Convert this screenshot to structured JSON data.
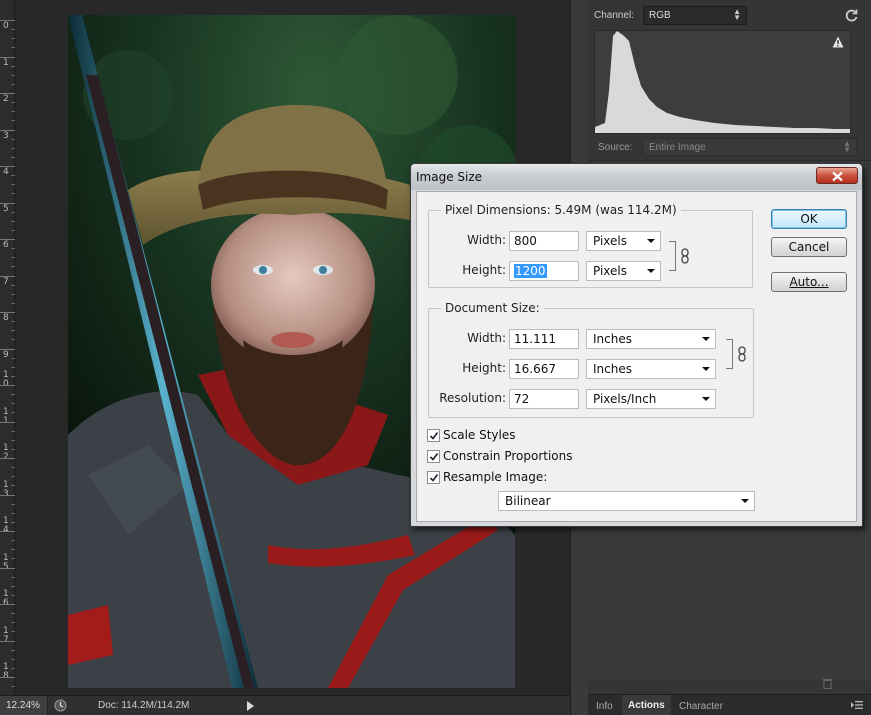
{
  "ruler": {
    "labels": [
      "0",
      "1",
      "2",
      "3",
      "4",
      "5",
      "6",
      "7",
      "8",
      "9",
      "1\n0",
      "1\n1",
      "1\n2",
      "1\n3",
      "1\n4",
      "1\n5",
      "1\n6",
      "1\n7",
      "1\n8"
    ]
  },
  "canvas": {
    "photo_description_icon": "portrait-photo"
  },
  "status_bar": {
    "zoom": "12.24%",
    "doc_size": "Doc: 114.2M/114.2M"
  },
  "histogram_panel": {
    "channel_label": "Channel:",
    "channel_value": "RGB",
    "source_label": "Source:",
    "source_value": "Entire Image"
  },
  "panel_tabs": [
    {
      "label": "Info",
      "active": false
    },
    {
      "label": "Actions",
      "active": true
    },
    {
      "label": "Character",
      "active": false
    }
  ],
  "dialog": {
    "title": "Image Size",
    "pixel_dimensions": {
      "title": "Pixel Dimensions:  5.49M (was 114.2M)",
      "width_label": "Width:",
      "width_value": "800",
      "width_unit": "Pixels",
      "height_label": "Height:",
      "height_value": "1200",
      "height_unit": "Pixels"
    },
    "document_size": {
      "title": "Document Size:",
      "width_label": "Width:",
      "width_value": "11.111",
      "width_unit": "Inches",
      "height_label": "Height:",
      "height_value": "16.667",
      "height_unit": "Inches",
      "resolution_label": "Resolution:",
      "resolution_value": "72",
      "resolution_unit": "Pixels/Inch"
    },
    "buttons": {
      "ok": "OK",
      "cancel": "Cancel",
      "auto": "Auto..."
    },
    "options": {
      "scale_styles": "Scale Styles",
      "constrain_proportions": "Constrain Proportions",
      "resample_image": "Resample Image:",
      "resample_method": "Bilinear"
    }
  },
  "colors": {
    "accent_selection": "#3399ff",
    "close_button": "#c9533f",
    "panel_bg": "#353535"
  }
}
